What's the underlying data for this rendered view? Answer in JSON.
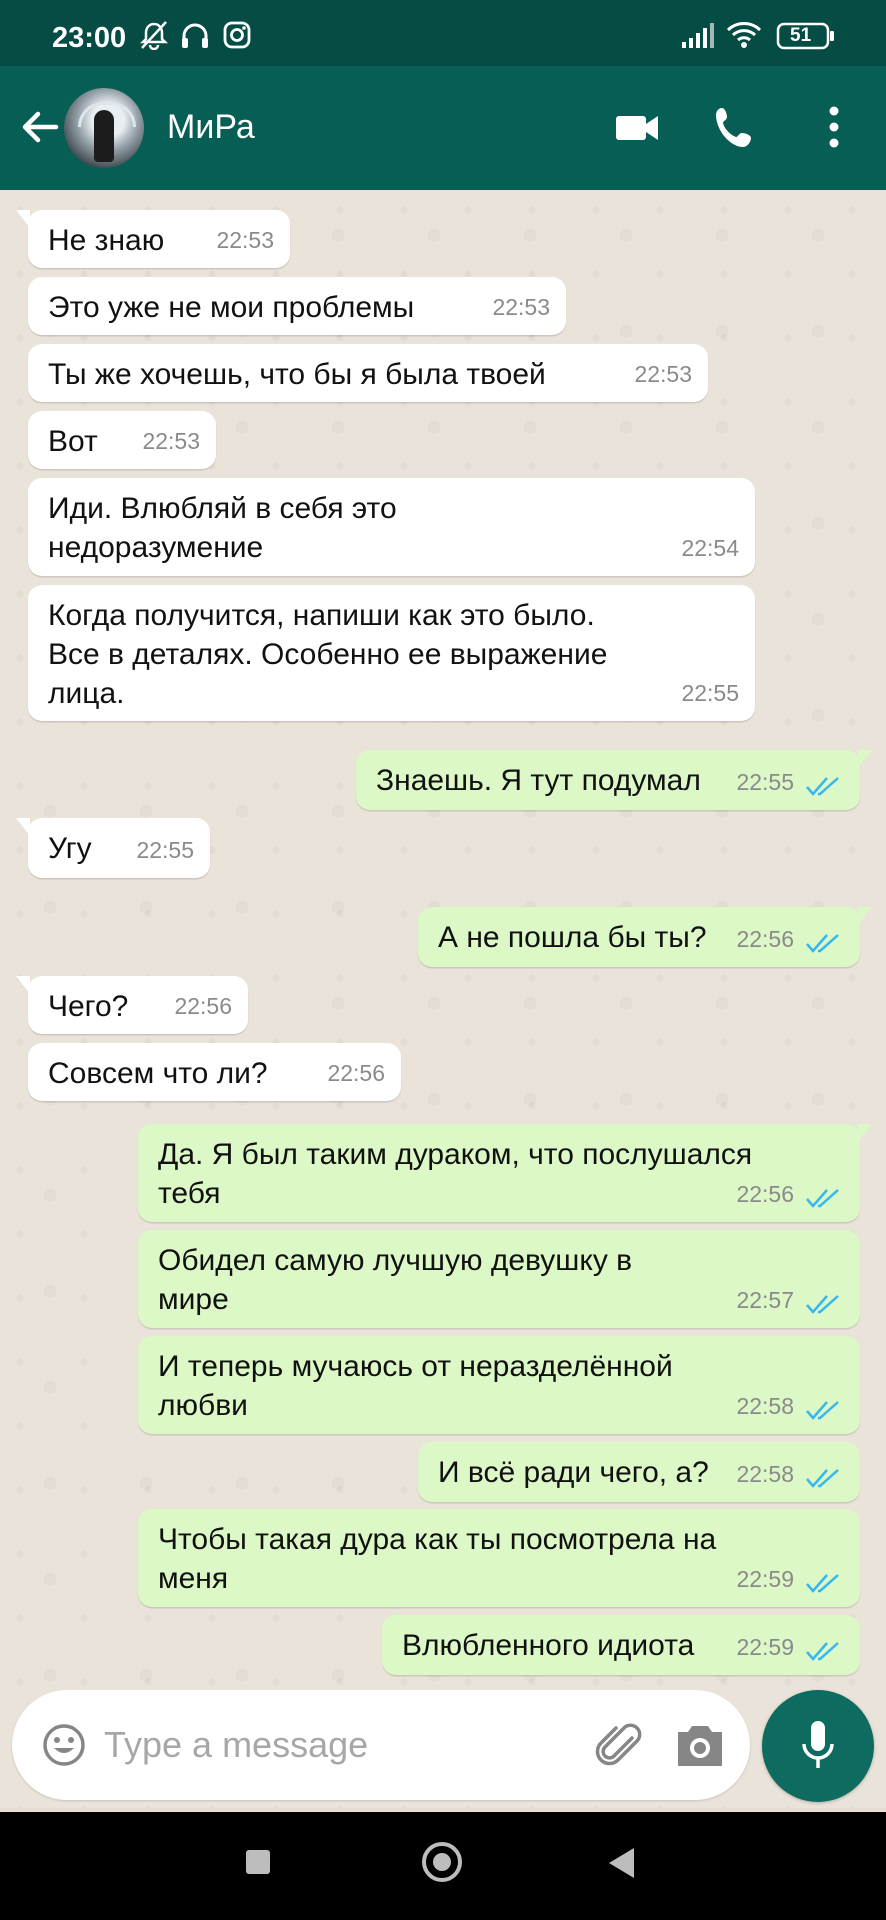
{
  "status_bar": {
    "time": "23:00",
    "battery": "51"
  },
  "header": {
    "contact_name": "МиРа"
  },
  "messages": [
    {
      "dir": "in",
      "text": "Не знаю",
      "time": "22:53"
    },
    {
      "dir": "in",
      "text": "Это уже не мои проблемы",
      "time": "22:53"
    },
    {
      "dir": "in",
      "text": "Ты же хочешь, что бы я была твоей",
      "time": "22:53"
    },
    {
      "dir": "in",
      "text": "Вот",
      "time": "22:53"
    },
    {
      "dir": "in",
      "text": "Иди. Влюбляй в себя это\nнедоразумение",
      "time": "22:54"
    },
    {
      "dir": "in",
      "text": "Когда получится, напиши как это было.\nВсе в деталях. Особенно ее выражение\nлица.",
      "time": "22:55"
    },
    {
      "dir": "out",
      "text": "Знаешь. Я тут подумал",
      "time": "22:55"
    },
    {
      "dir": "in",
      "text": "Угу",
      "time": "22:55"
    },
    {
      "dir": "out",
      "text": "А не пошла бы ты?",
      "time": "22:56"
    },
    {
      "dir": "in",
      "text": "Чего?",
      "time": "22:56"
    },
    {
      "dir": "in",
      "text": "Совсем что ли?",
      "time": "22:56"
    },
    {
      "dir": "out",
      "text": "Да. Я был таким дураком, что послушался\nтебя",
      "time": "22:56"
    },
    {
      "dir": "out",
      "text": "Обидел самую лучшую девушку в\nмире",
      "time": "22:57"
    },
    {
      "dir": "out",
      "text": "И теперь мучаюсь от неразделённой\nлюбви",
      "time": "22:58"
    },
    {
      "dir": "out",
      "text": "И всё ради чего, а?",
      "time": "22:58"
    },
    {
      "dir": "out",
      "text": "Чтобы такая дура как ты посмотрела на\nменя",
      "time": "22:59"
    },
    {
      "dir": "out",
      "text": "Влюбленного идиота",
      "time": "22:59"
    }
  ],
  "input": {
    "placeholder": "Type a message"
  },
  "colors": {
    "header": "#075e54",
    "status_bar": "#054c44",
    "outgoing": "#dcf8c6",
    "incoming": "#ffffff",
    "read_ticks": "#34b7f1"
  }
}
